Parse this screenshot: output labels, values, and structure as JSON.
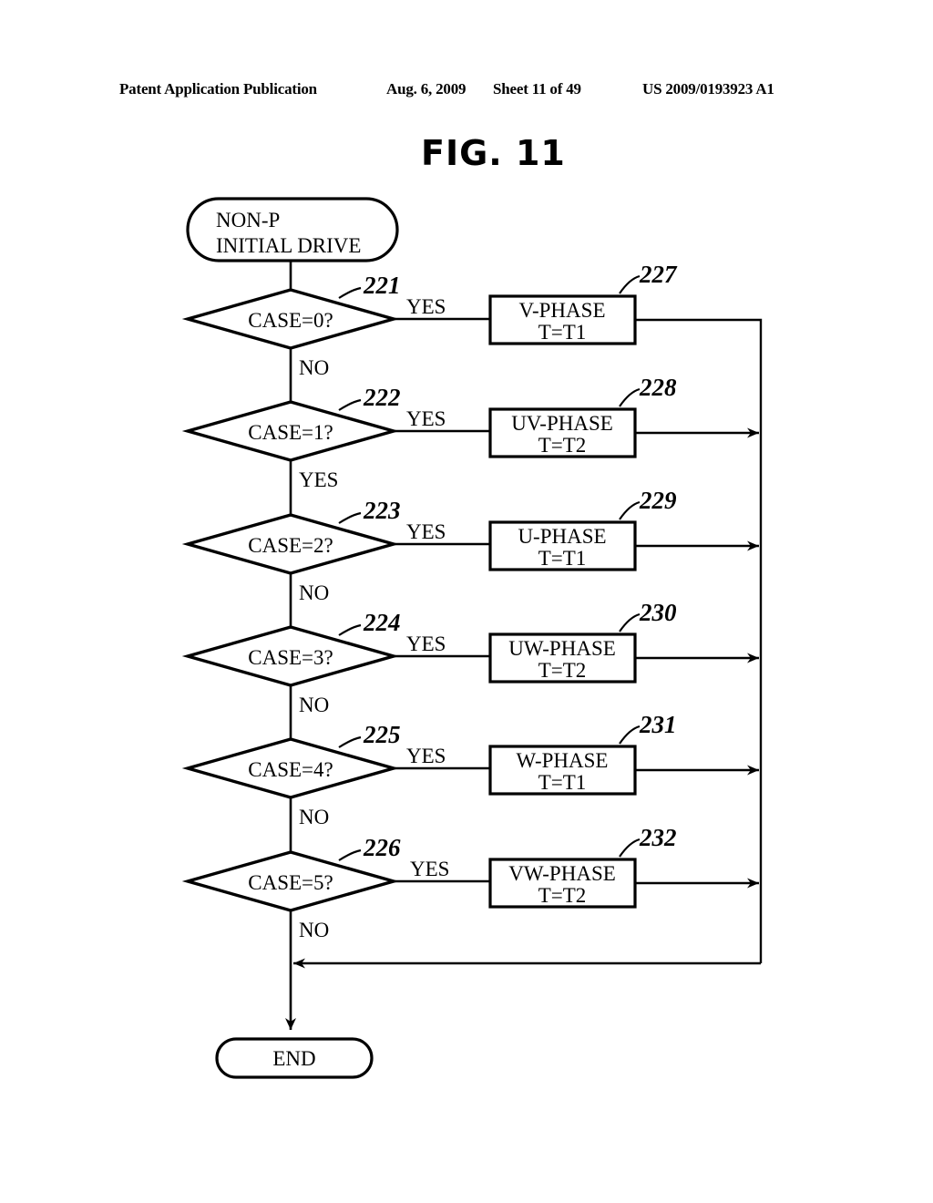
{
  "header": {
    "publication": "Patent Application Publication",
    "date": "Aug. 6, 2009",
    "sheet": "Sheet 11 of 49",
    "patent_number": "US 2009/0193923 A1"
  },
  "figure": {
    "title": "FIG. 11"
  },
  "flowchart": {
    "start": {
      "line1": "NON-P",
      "line2": "INITIAL DRIVE"
    },
    "end": {
      "label": "END"
    },
    "decisions": [
      {
        "ref": "221",
        "label": "CASE=0?",
        "yes_label": "YES",
        "down_label": "NO"
      },
      {
        "ref": "222",
        "label": "CASE=1?",
        "yes_label": "YES",
        "down_label": "YES"
      },
      {
        "ref": "223",
        "label": "CASE=2?",
        "yes_label": "YES",
        "down_label": "NO"
      },
      {
        "ref": "224",
        "label": "CASE=3?",
        "yes_label": "YES",
        "down_label": "NO"
      },
      {
        "ref": "225",
        "label": "CASE=4?",
        "yes_label": "YES",
        "down_label": "NO"
      },
      {
        "ref": "226",
        "label": "CASE=5?",
        "yes_label": "YES",
        "down_label": "NO"
      }
    ],
    "processes": [
      {
        "ref": "227",
        "line1": "V-PHASE",
        "line2": "T=T1"
      },
      {
        "ref": "228",
        "line1": "UV-PHASE",
        "line2": "T=T2"
      },
      {
        "ref": "229",
        "line1": "U-PHASE",
        "line2": "T=T1"
      },
      {
        "ref": "230",
        "line1": "UW-PHASE",
        "line2": "T=T2"
      },
      {
        "ref": "231",
        "line1": "W-PHASE",
        "line2": "T=T1"
      },
      {
        "ref": "232",
        "line1": "VW-PHASE",
        "line2": "T=T2"
      }
    ]
  },
  "colors": {
    "ink": "#000000",
    "paper": "#ffffff"
  }
}
